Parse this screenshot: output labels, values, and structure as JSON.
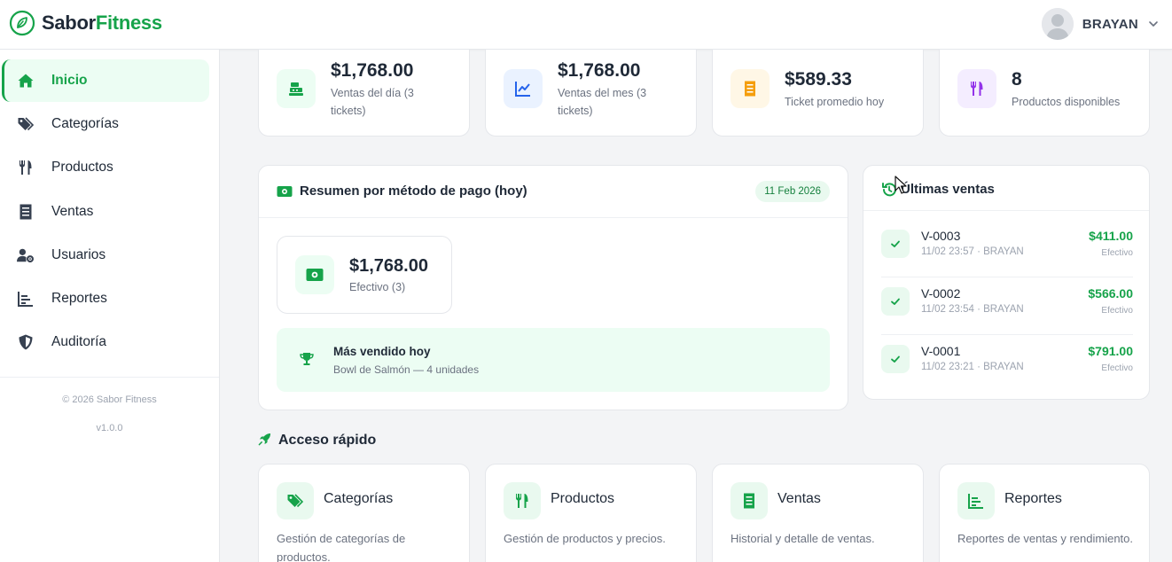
{
  "header": {
    "brand_first": "Sabor",
    "brand_second": "Fitness",
    "user_name": "BRAYAN"
  },
  "sidebar": {
    "items": [
      {
        "label": "Inicio",
        "icon": "home-icon",
        "active": true
      },
      {
        "label": "Categorías",
        "icon": "tags-icon"
      },
      {
        "label": "Productos",
        "icon": "utensils-icon"
      },
      {
        "label": "Ventas",
        "icon": "receipt-icon"
      },
      {
        "label": "Usuarios",
        "icon": "users-cog-icon"
      },
      {
        "label": "Reportes",
        "icon": "chart-bars-icon"
      },
      {
        "label": "Auditoría",
        "icon": "shield-icon"
      }
    ],
    "copyright": "© 2026 Sabor Fitness",
    "version": "v1.0.0"
  },
  "stats": [
    {
      "value": "$1,768.00",
      "label": "Ventas del día (3 tickets)",
      "icon": "cash-register-icon"
    },
    {
      "value": "$1,768.00",
      "label": "Ventas del mes (3 tickets)",
      "icon": "line-chart-icon"
    },
    {
      "value": "$589.33",
      "label": "Ticket promedio hoy",
      "icon": "receipt-icon"
    },
    {
      "value": "8",
      "label": "Productos disponibles",
      "icon": "utensils-icon"
    }
  ],
  "payment_summary": {
    "title": "Resumen por método de pago (hoy)",
    "date_badge": "11 Feb 2026",
    "method_amount": "$1,768.00",
    "method_label": "Efectivo (3)",
    "best_seller_title": "Más vendido hoy",
    "best_seller_detail": "Bowl de Salmón — 4 unidades"
  },
  "recent_sales": {
    "title": "Últimas ventas",
    "items": [
      {
        "code": "V-0003",
        "meta": "11/02 23:57 · BRAYAN",
        "amount": "$411.00",
        "method": "Efectivo"
      },
      {
        "code": "V-0002",
        "meta": "11/02 23:54 · BRAYAN",
        "amount": "$566.00",
        "method": "Efectivo"
      },
      {
        "code": "V-0001",
        "meta": "11/02 23:21 · BRAYAN",
        "amount": "$791.00",
        "method": "Efectivo"
      }
    ]
  },
  "quick_access": {
    "title": "Acceso rápido",
    "items": [
      {
        "title": "Categorías",
        "desc": "Gestión de categorías de productos.",
        "icon": "tags-icon"
      },
      {
        "title": "Productos",
        "desc": "Gestión de productos y precios.",
        "icon": "utensils-icon"
      },
      {
        "title": "Ventas",
        "desc": "Historial y detalle de ventas.",
        "icon": "receipt-icon"
      },
      {
        "title": "Reportes",
        "desc": "Reportes de ventas y rendimiento.",
        "icon": "chart-bars-icon"
      }
    ]
  },
  "colors": {
    "accent": "#16a34a",
    "accent_light": "#ecfdf3",
    "blue_light": "#eaf2ff",
    "amber_light": "#fff7e6",
    "purple_light": "#f4edff"
  }
}
